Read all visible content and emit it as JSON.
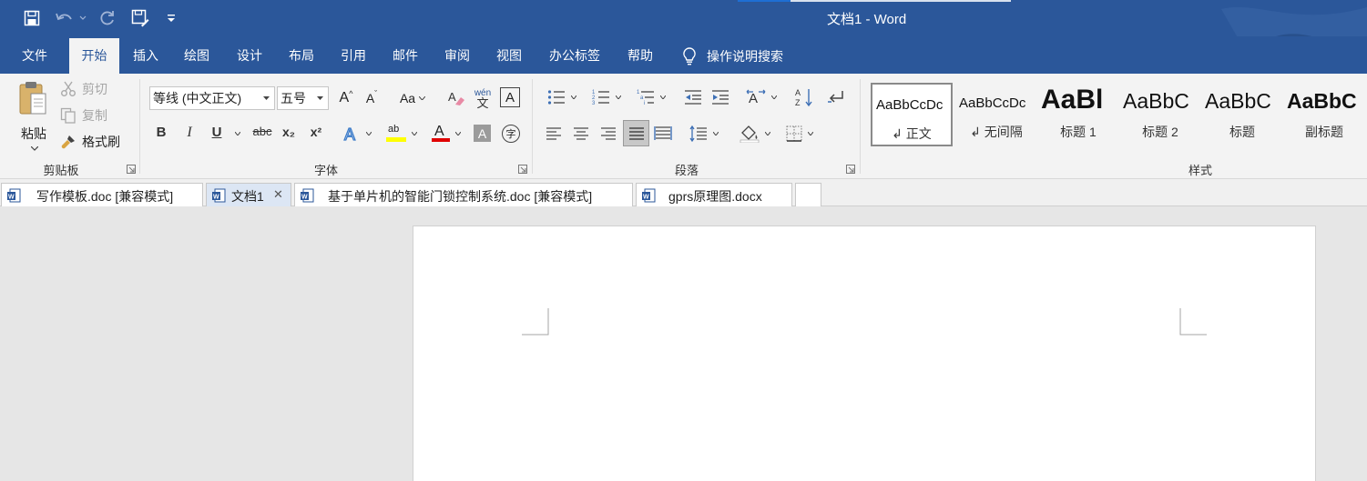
{
  "window": {
    "title": "文档1  -  Word"
  },
  "quick_access": [
    {
      "name": "save-icon"
    },
    {
      "name": "undo-icon"
    },
    {
      "name": "redo-icon"
    },
    {
      "name": "save-as-icon"
    },
    {
      "name": "customize-icon"
    }
  ],
  "menu": {
    "tabs": [
      "文件",
      "开始",
      "插入",
      "绘图",
      "设计",
      "布局",
      "引用",
      "邮件",
      "审阅",
      "视图",
      "办公标签",
      "帮助"
    ],
    "active": "开始",
    "tell_me": "操作说明搜索"
  },
  "clipboard": {
    "label": "剪贴板",
    "paste": "粘贴",
    "cut": "剪切",
    "copy": "复制",
    "format_painter": "格式刷"
  },
  "font": {
    "label": "字体",
    "font_name": "等线 (中文正文)",
    "font_size": "五号",
    "grow": "A",
    "shrink": "A",
    "change_case": "Aa",
    "bold": "B",
    "italic": "I",
    "underline": "U",
    "strikethrough": "abc",
    "subscript": "x₂",
    "superscript": "x²",
    "highlight": "ab",
    "font_color": "A",
    "char_shading": "A",
    "char_border": "A",
    "enclose": "字",
    "phonetic_top": "wén",
    "phonetic_bottom": "文",
    "accent_highlight": "#ffff00",
    "accent_fontcolor": "#e00000"
  },
  "paragraph": {
    "label": "段落"
  },
  "styles": {
    "label": "样式",
    "items": [
      {
        "sample": "AaBbCcDc",
        "name": "↲ 正文"
      },
      {
        "sample": "AaBbCcDc",
        "name": "↲ 无间隔"
      },
      {
        "sample": "AaBl",
        "name": "标题 1"
      },
      {
        "sample": "AaBbC",
        "name": "标题 2"
      },
      {
        "sample": "AaBbC",
        "name": "标题"
      },
      {
        "sample": "AaBbC",
        "name": "副标题"
      }
    ]
  },
  "doc_tabs": [
    {
      "label": "写作模板.doc [兼容模式]",
      "active": false
    },
    {
      "label": "文档1",
      "active": true,
      "close": "✕"
    },
    {
      "label": "基于单片机的智能门锁控制系统.doc [兼容模式]",
      "active": false
    },
    {
      "label": "gprs原理图.docx",
      "active": false
    },
    {
      "label": "",
      "active": false
    }
  ],
  "colors": {
    "brand": "#2b579a",
    "ribbon_bg": "#f3f3f3",
    "canvas_bg": "#e6e6e6"
  }
}
